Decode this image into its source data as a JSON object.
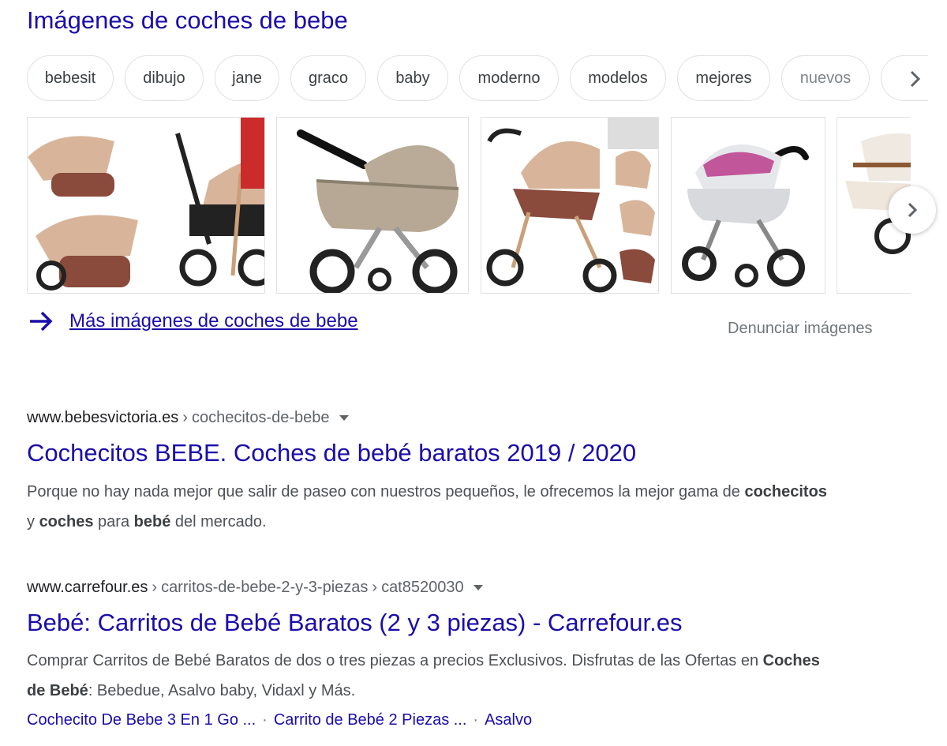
{
  "images_section": {
    "title": "Imágenes de coches de bebe",
    "chips": [
      "bebesit",
      "dibujo",
      "jane",
      "graco",
      "baby",
      "moderno",
      "modelos",
      "mejores",
      "nuevos"
    ],
    "chips_next_icon": "chevron-right-icon",
    "thumbnails": [
      {
        "alt": "stroller-set-rose"
      },
      {
        "alt": "stroller-beige"
      },
      {
        "alt": "stroller-rose-collage"
      },
      {
        "alt": "stroller-pink-grey"
      },
      {
        "alt": "stroller-white-partial"
      }
    ],
    "more_link": "Más imágenes de coches de bebe",
    "more_link_icon": "arrow-right-icon",
    "report": "Denunciar imágenes"
  },
  "results": [
    {
      "site": "www.bebesvictoria.es",
      "path": [
        "cochecitos-de-bebe"
      ],
      "title": "Cochecitos BEBE. Coches de bebé baratos 2019 / 2020",
      "snippet_parts": [
        {
          "t": "Porque no hay nada mejor que salir de paseo con nuestros pequeños, le ofrecemos la mejor gama de ",
          "b": false
        },
        {
          "t": "cochecitos",
          "b": true
        },
        {
          "t": " y ",
          "b": false
        },
        {
          "t": "coches",
          "b": true
        },
        {
          "t": " para ",
          "b": false
        },
        {
          "t": "bebé",
          "b": true
        },
        {
          "t": " del mercado.",
          "b": false
        }
      ]
    },
    {
      "site": "www.carrefour.es",
      "path": [
        "carritos-de-bebe-2-y-3-piezas",
        "cat8520030"
      ],
      "title": "Bebé: Carritos de Bebé Baratos (2 y 3 piezas) - Carrefour.es",
      "snippet_parts": [
        {
          "t": "Comprar Carritos de Bebé Baratos de dos o tres piezas a precios Exclusivos. Disfrutas de las Ofertas en ",
          "b": false
        },
        {
          "t": "Coches de Bebé",
          "b": true
        },
        {
          "t": ": Bebedue, Asalvo baby, Vidaxl y Más.",
          "b": false
        }
      ],
      "sitelinks": [
        "Cochecito De Bebe 3 En 1 Go ...",
        "Carrito de Bebé 2 Piezas ...",
        "Asalvo"
      ]
    }
  ],
  "colors": {
    "link": "#1a0dab",
    "text": "#202124",
    "muted": "#70757a",
    "border": "#dfe1e5"
  }
}
